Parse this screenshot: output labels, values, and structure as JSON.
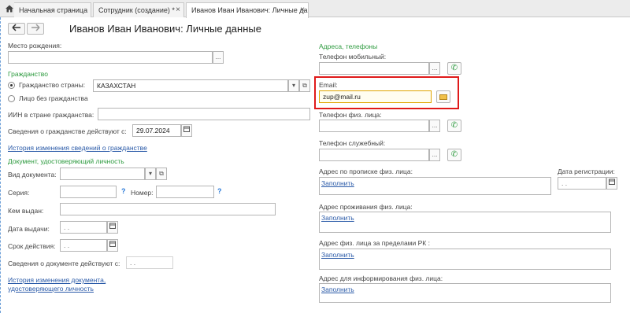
{
  "tabs": [
    {
      "label": "Начальная страница"
    },
    {
      "label": "Сотрудник (создание) *"
    },
    {
      "label": "Иванов Иван Иванович: Личные данные"
    }
  ],
  "header": {
    "title": "Иванов Иван Иванович: Личные данные"
  },
  "left": {
    "birthplace_label": "Место рождения:",
    "birthplace_value": "",
    "citizenship_section": "Гражданство",
    "radio_country_label": "Гражданство страны:",
    "country_value": "КАЗАХСТАН",
    "radio_stateless_label": "Лицо без гражданства",
    "iin_label": "ИИН в стране гражданства:",
    "citizenship_valid_label": "Сведения о гражданстве действуют с:",
    "citizenship_valid_value": "29.07.2024",
    "citizenship_history_link": "История изменения сведений о гражданстве",
    "document_section": "Документ, удостоверяющий личность",
    "doc_type_label": "Вид документа:",
    "series_label": "Серия:",
    "number_label": "Номер:",
    "issued_by_label": "Кем выдан:",
    "issue_date_label": "Дата выдачи:",
    "issue_date_value": ". .",
    "expiry_label": "Срок действия:",
    "expiry_value": ". .",
    "doc_valid_label": "Сведения о документе действуют с:",
    "doc_valid_value": ". .",
    "doc_history_link_line1": "История изменения документа,",
    "doc_history_link_line2": "удостоверяющего личность"
  },
  "right": {
    "section": "Адреса, телефоны",
    "mobile_label": "Телефон мобильный:",
    "email_label": "Email:",
    "email_value": "zup@mail.ru",
    "personal_phone_label": "Телефон физ. лица:",
    "work_phone_label": "Телефон служебный:",
    "reg_address_label": "Адрес по прописке физ. лица:",
    "reg_date_label": "Дата регистрации:",
    "reg_date_value": ". .",
    "living_address_label": "Адрес проживания физ. лица:",
    "abroad_address_label": "Адрес физ. лица за пределами РК :",
    "info_address_label": "Адрес для информирования физ. лица:",
    "fill_link": "Заполнить"
  },
  "colors": {
    "section_green": "#2c9a3e",
    "link_blue": "#2a5aa8",
    "highlight_red": "#e01a1a"
  }
}
